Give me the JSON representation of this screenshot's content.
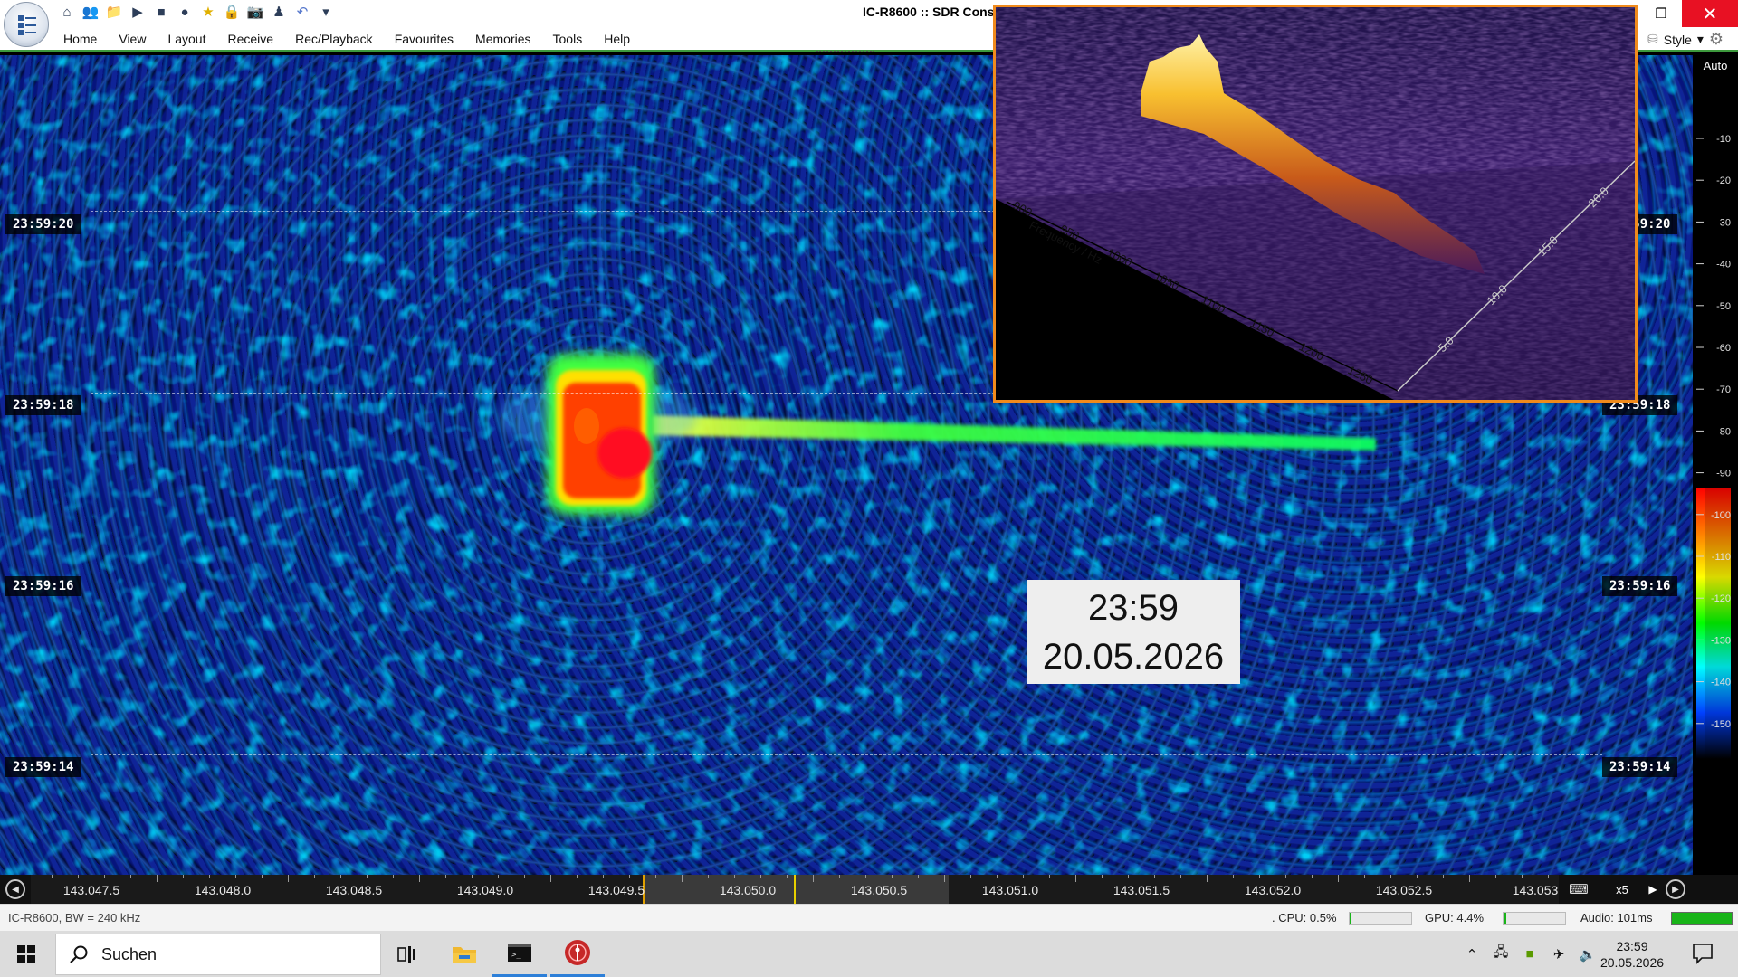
{
  "window": {
    "title": "IC-R8600 :: SDR Console"
  },
  "ribbon": {
    "menu": [
      "Home",
      "View",
      "Layout",
      "Receive",
      "Rec/Playback",
      "Favourites",
      "Memories",
      "Tools",
      "Help"
    ],
    "style_label": "Style"
  },
  "quick_access_icons": [
    "home-icon",
    "users-icon",
    "folder-icon",
    "play-icon",
    "stop-icon",
    "disc-icon",
    "star-icon",
    "lock-icon",
    "camera-icon",
    "bell-icon",
    "undo-icon",
    "dropdown-icon"
  ],
  "waterfall": {
    "timestamps": [
      "23:59:20",
      "23:59:18",
      "23:59:16",
      "23:59:14"
    ]
  },
  "clock_overlay": {
    "time": "23:59",
    "date": "20.05.2026"
  },
  "spectrum_3d": {
    "freq_axis_label": "Frequency / Hz",
    "freq_ticks": [
      "900",
      "950",
      "1000",
      "1050",
      "1100",
      "1150",
      "1200",
      "1250"
    ],
    "time_ticks": [
      "5.0",
      "10.0",
      "15.0",
      "20.0"
    ]
  },
  "level_scale": {
    "mode_label": "Auto",
    "ticks": [
      "-10",
      "-20",
      "-30",
      "-40",
      "-50",
      "-60",
      "-70",
      "-80",
      "-90",
      "-100",
      "-110",
      "-120",
      "-130",
      "-140",
      "-150"
    ],
    "colormap": [
      "#ff0000",
      "#ff8000",
      "#ffff00",
      "#00ff00",
      "#00ffff",
      "#0040ff",
      "#000000"
    ]
  },
  "frequency_axis": {
    "ticks": [
      "143.047.5",
      "143.048.0",
      "143.048.5",
      "143.049.0",
      "143.049.5",
      "143.050.0",
      "143.050.5",
      "143.051.0",
      "143.051.5",
      "143.052.0",
      "143.052.5",
      "143.053"
    ],
    "zoom": "x5"
  },
  "status": {
    "radio": "IC-R8600, BW = 240 kHz",
    "cpu": ". CPU: 0.5%",
    "cpu_fraction": 0.005,
    "gpu": "GPU: 4.4%",
    "gpu_fraction": 0.044,
    "audio": "Audio: 101ms",
    "audio_fraction": 1.0
  },
  "taskbar": {
    "search_label": "Suchen",
    "clock_time": "23:59",
    "clock_date": "20.05.2026"
  },
  "colors": {
    "accent_green": "#3d9a3d",
    "close_red": "#e81123",
    "inset_border": "#f08a1c"
  }
}
